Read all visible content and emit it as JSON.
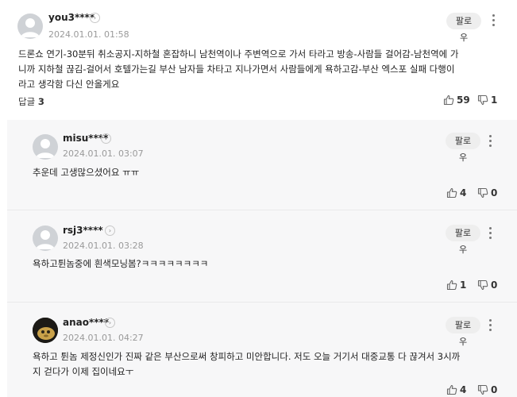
{
  "main_comment": {
    "nickname": "you3****",
    "date": "2024.01.01. 01:58",
    "follow_label": "팔로우",
    "body_lines": [
      "드론쇼 연기-30분뒤 취소공지-지하철 혼잡하니 남천역이나 주변역으로 가서 타라고 방송-사람들 걸어감-남천역에 가",
      "니까 지하철 끊김-걸어서 호텔가는길 부산 남자들 차타고 지나가면서 사람들에게 욕하고감-부산 엑스포 실패 다행이",
      "라고 생각함 다신 안올게요"
    ],
    "reply_label": "답글",
    "reply_count": "3",
    "likes": "59",
    "dislikes": "1"
  },
  "replies": [
    {
      "nickname": "misu****",
      "date": "2024.01.01. 03:07",
      "follow_label": "팔로우",
      "body_lines": [
        "추운데 고생많으셨어요 ㅠㅠ"
      ],
      "likes": "4",
      "dislikes": "0"
    },
    {
      "nickname": "rsj3****",
      "date": "2024.01.01. 03:28",
      "follow_label": "팔로우",
      "body_lines": [
        "욕하고튄놈중에 흰색모닝봄?ㅋㅋㅋㅋㅋㅋㅋㅋ"
      ],
      "likes": "1",
      "dislikes": "0"
    },
    {
      "nickname": "anao****",
      "date": "2024.01.01. 04:27",
      "follow_label": "팔로우",
      "body_lines": [
        "욕하고 튄놈 제정신인가 진짜 같은 부산으로써 창피하고 미안합니다. 저도 오늘 거기서 대중교통 다 끊겨서 3시까",
        "지 걷다가 이제 집이네요ㅜ"
      ],
      "likes": "4",
      "dislikes": "0"
    }
  ],
  "icons": {
    "avatar_default": "user-silhouette-icon",
    "avatar_photo": "dark-photo-avatar",
    "more": "vertical-ellipsis-icon",
    "chevron": "chevron-right-icon",
    "like": "thumbs-up-icon",
    "dislike": "thumbs-down-icon"
  },
  "colors": {
    "reply_background": "#f7f7f8",
    "follow_background": "#eeeeee",
    "meta_text": "#9a9a9a"
  }
}
